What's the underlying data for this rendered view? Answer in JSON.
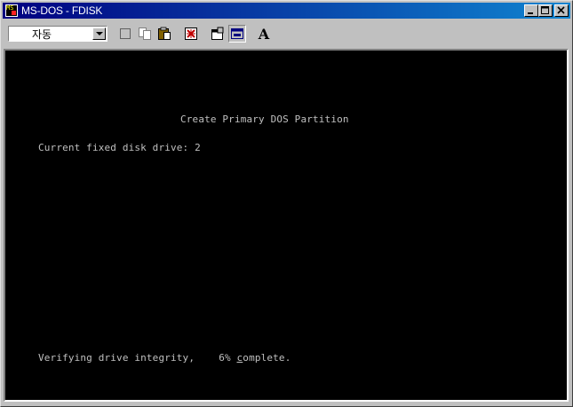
{
  "window": {
    "title": "MS-DOS - FDISK",
    "icon": "ms-dos-icon",
    "controls": {
      "minimize": "minimize-icon",
      "maximize": "maximize-icon",
      "close": "close-icon"
    }
  },
  "toolbar": {
    "font_size_value": "자동",
    "buttons": [
      "mark-icon",
      "copy-icon",
      "paste-icon",
      "fullscreen-icon",
      "properties-icon",
      "background-icon",
      "font-icon"
    ],
    "font_button_label": "A"
  },
  "console": {
    "heading": "Create Primary DOS Partition",
    "drive_line": "Current fixed disk drive: 2",
    "status": {
      "prefix": "Verifying drive integrity,",
      "percent": "6%",
      "cursor_char": "c",
      "suffix": "omplete."
    },
    "colors": {
      "background": "#000000",
      "text": "#c0c0c0"
    }
  }
}
